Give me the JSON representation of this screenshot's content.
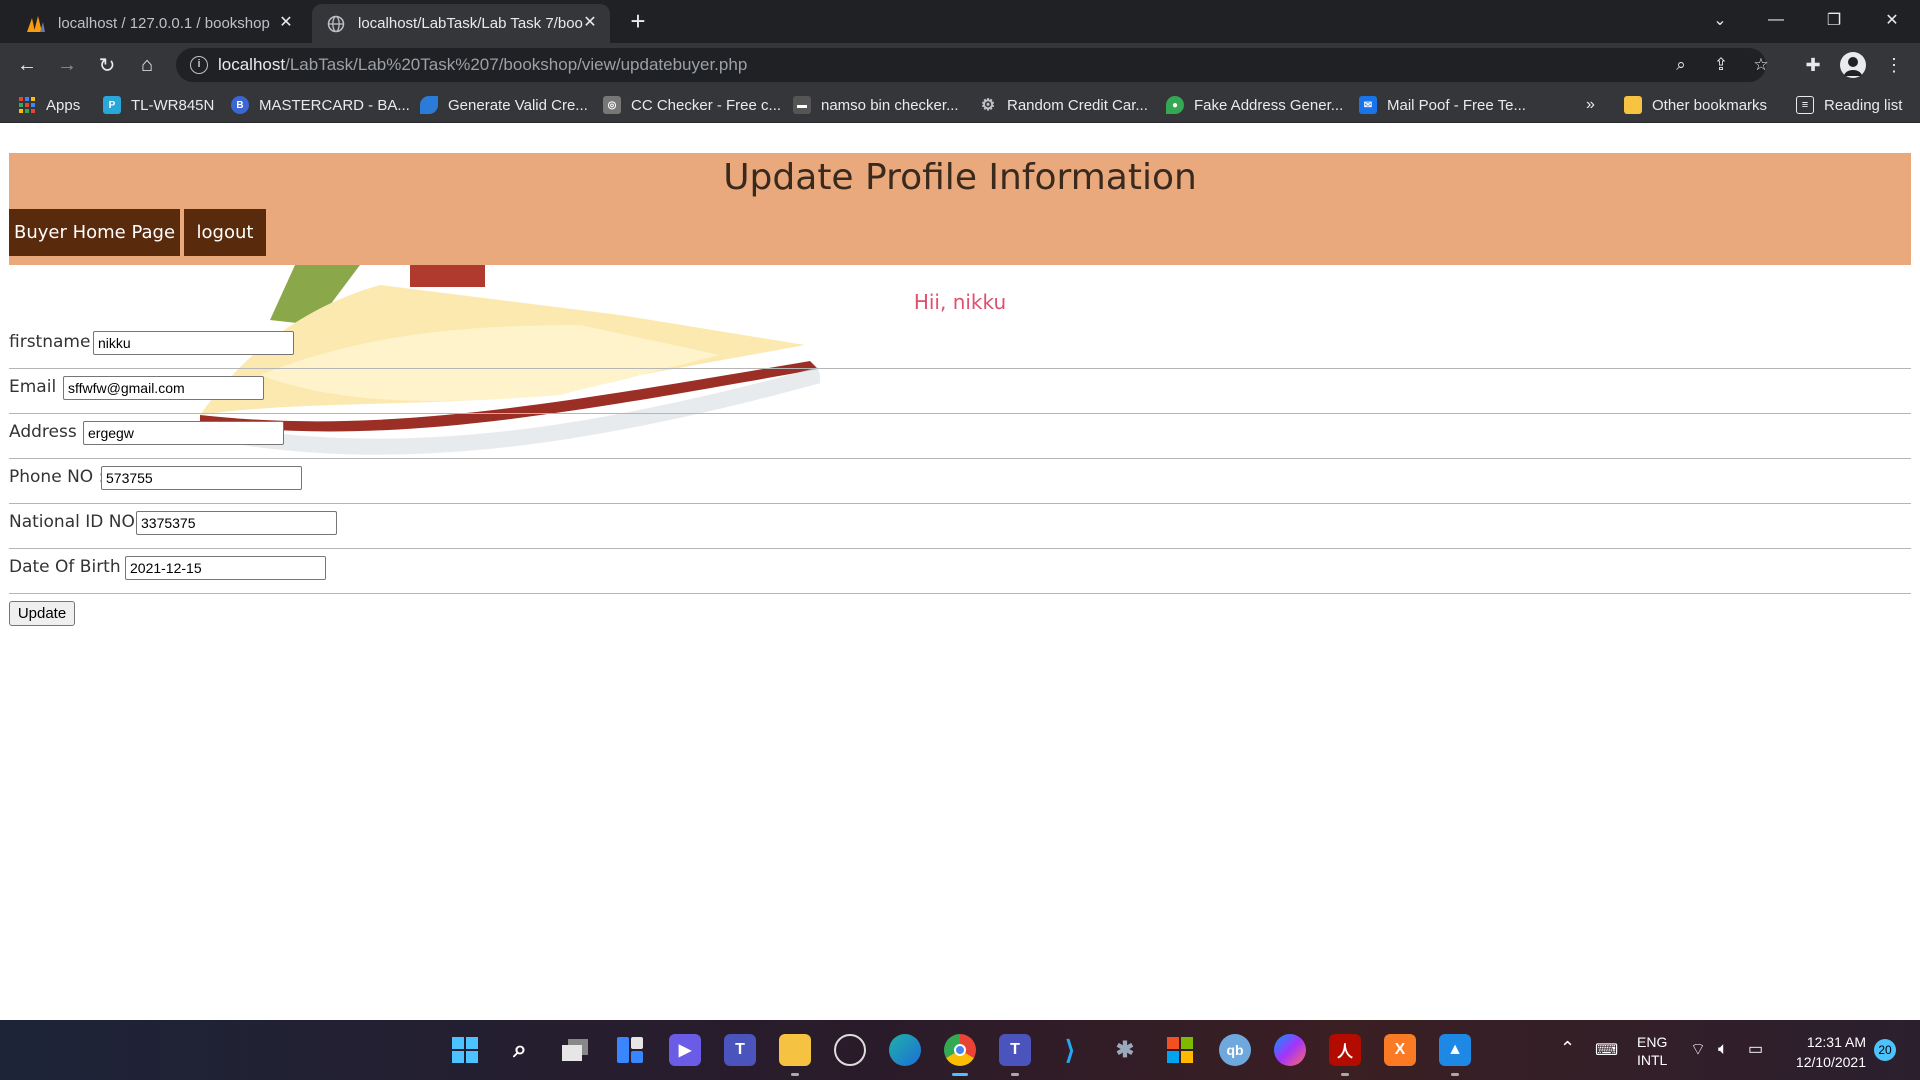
{
  "browser": {
    "tabs": [
      {
        "title": "localhost / 127.0.0.1 / bookshop",
        "active": false
      },
      {
        "title": "localhost/LabTask/Lab Task 7/boo",
        "active": true
      }
    ],
    "url_host": "localhost",
    "url_path": "/LabTask/Lab%20Task%207/bookshop/view/updatebuyer.php",
    "bookmarks": [
      {
        "label": "Apps",
        "color": "#4285f4"
      },
      {
        "label": "TL-WR845N",
        "color": "#2aa7d9"
      },
      {
        "label": "MASTERCARD - BA...",
        "color": "#3a66d6"
      },
      {
        "label": "Generate Valid Cre...",
        "color": "#2b7bd8"
      },
      {
        "label": "CC Checker - Free c...",
        "color": "#777777"
      },
      {
        "label": "namso bin checker...",
        "color": "#555555"
      },
      {
        "label": "Random Credit Car...",
        "color": "#9aa0a6"
      },
      {
        "label": "Fake Address Gener...",
        "color": "#34a853"
      },
      {
        "label": "Mail Poof - Free Te...",
        "color": "#1a73e8"
      }
    ],
    "overflow": "»",
    "other_bookmarks": "Other bookmarks",
    "reading_list": "Reading list"
  },
  "page": {
    "title": "Update Profile Information",
    "nav": {
      "home": "Buyer Home Page",
      "logout": "logout"
    },
    "greeting": "Hii, nikku",
    "fields": [
      {
        "label": "firstname :",
        "value": "nikku"
      },
      {
        "label": "Email :",
        "value": "sffwfw@gmail.com"
      },
      {
        "label": "Address :",
        "value": "ergegw"
      },
      {
        "label": "Phone NO :",
        "value": "573755"
      },
      {
        "label": "National ID NO:",
        "value": "3375375"
      },
      {
        "label": "Date Of Birth :",
        "value": "2021-12-15"
      }
    ],
    "submit": "Update",
    "colors": {
      "header": "#e9a97d",
      "nav_button": "#5a2a0c",
      "greeting": "#e0506e"
    }
  },
  "taskbar": {
    "icons": [
      "windows-start-icon",
      "search-icon",
      "task-view-icon",
      "widgets-icon",
      "chat-icon",
      "teams-icon",
      "file-explorer-icon",
      "obs-icon",
      "edge-icon",
      "chrome-icon",
      "teams-work-icon",
      "vscode-icon",
      "bug-app-icon",
      "office-icon",
      "qbittorrent-icon",
      "messenger-icon",
      "acrobat-icon",
      "xampp-icon",
      "photos-icon"
    ],
    "lang1": "ENG",
    "lang2": "INTL",
    "time": "12:31 AM",
    "date": "12/10/2021",
    "notifications": "20"
  }
}
